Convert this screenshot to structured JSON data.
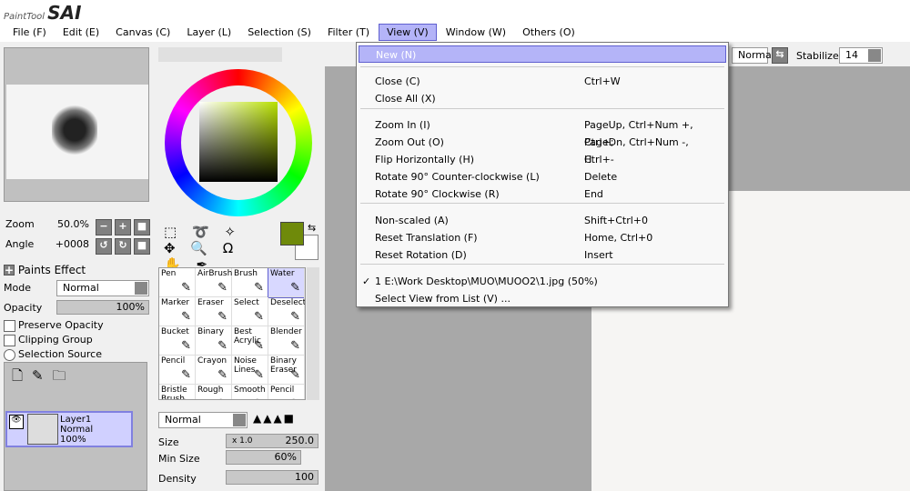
{
  "app": {
    "logo": "SAI",
    "logo_sub": "PaintTool"
  },
  "menubar": [
    "File (F)",
    "Edit (E)",
    "Canvas (C)",
    "Layer (L)",
    "Selection (S)",
    "Filter (T)",
    "View (V)",
    "Window (W)",
    "Others (O)"
  ],
  "navigator": {
    "zoom_label": "Zoom",
    "zoom_value": "50.0%",
    "angle_label": "Angle",
    "angle_value": "+0008"
  },
  "layer_panel": {
    "paints_effect": "Paints Effect",
    "mode_label": "Mode",
    "mode_value": "Normal",
    "opacity_label": "Opacity",
    "opacity_value": "100%",
    "preserve_opacity": "Preserve Opacity",
    "clipping_group": "Clipping Group",
    "selection_source": "Selection Source",
    "layer": {
      "name": "Layer1",
      "mode": "Normal",
      "opacity": "100%"
    }
  },
  "colors": {
    "primary": "#6f8a0a",
    "secondary": "#ffffff",
    "accent": "#b4b4f8"
  },
  "tools": [
    "Pen",
    "AirBrush",
    "Brush",
    "Water",
    "Marker",
    "Eraser",
    "Select",
    "Deselect",
    "Bucket",
    "Binary",
    "Best Acrylic",
    "Blender",
    "Pencil",
    "Crayon",
    "Noise Lines",
    "Binary Eraser",
    "Bristle Brush",
    "Rough",
    "Smooth",
    "Pencil"
  ],
  "brush": {
    "blend": "Normal",
    "size_label": "Size",
    "size_mult": "x 1.0",
    "size_value": "250.0",
    "min_size_label": "Min Size",
    "min_size_value": "60%",
    "density_label": "Density",
    "density_value": "100"
  },
  "toolbar": {
    "mode": "Normal",
    "stabilizer_label": "Stabilizer",
    "stabilizer_value": "14"
  },
  "view_menu": [
    {
      "label": "New (N)",
      "shortcut": ""
    },
    {
      "label": "Close (C)",
      "shortcut": "Ctrl+W"
    },
    {
      "label": "Close All (X)",
      "shortcut": ""
    },
    {
      "label": "Zoom In (I)",
      "shortcut": "PageUp, Ctrl+Num +, Ctrl+;"
    },
    {
      "label": "Zoom Out (O)",
      "shortcut": "PageDn, Ctrl+Num -, Ctrl+-"
    },
    {
      "label": "Flip Horizontally (H)",
      "shortcut": "H"
    },
    {
      "label": "Rotate 90° Counter-clockwise (L)",
      "shortcut": "Delete"
    },
    {
      "label": "Rotate 90° Clockwise (R)",
      "shortcut": "End"
    },
    {
      "label": "Non-scaled (A)",
      "shortcut": "Shift+Ctrl+0"
    },
    {
      "label": "Reset Translation (F)",
      "shortcut": "Home, Ctrl+0"
    },
    {
      "label": "Reset Rotation (D)",
      "shortcut": "Insert"
    },
    {
      "label": "1 E:\\Work Desktop\\MUO\\MUOO2\\1.jpg (50%)",
      "shortcut": ""
    },
    {
      "label": "Select View from List (V) ...",
      "shortcut": ""
    }
  ]
}
